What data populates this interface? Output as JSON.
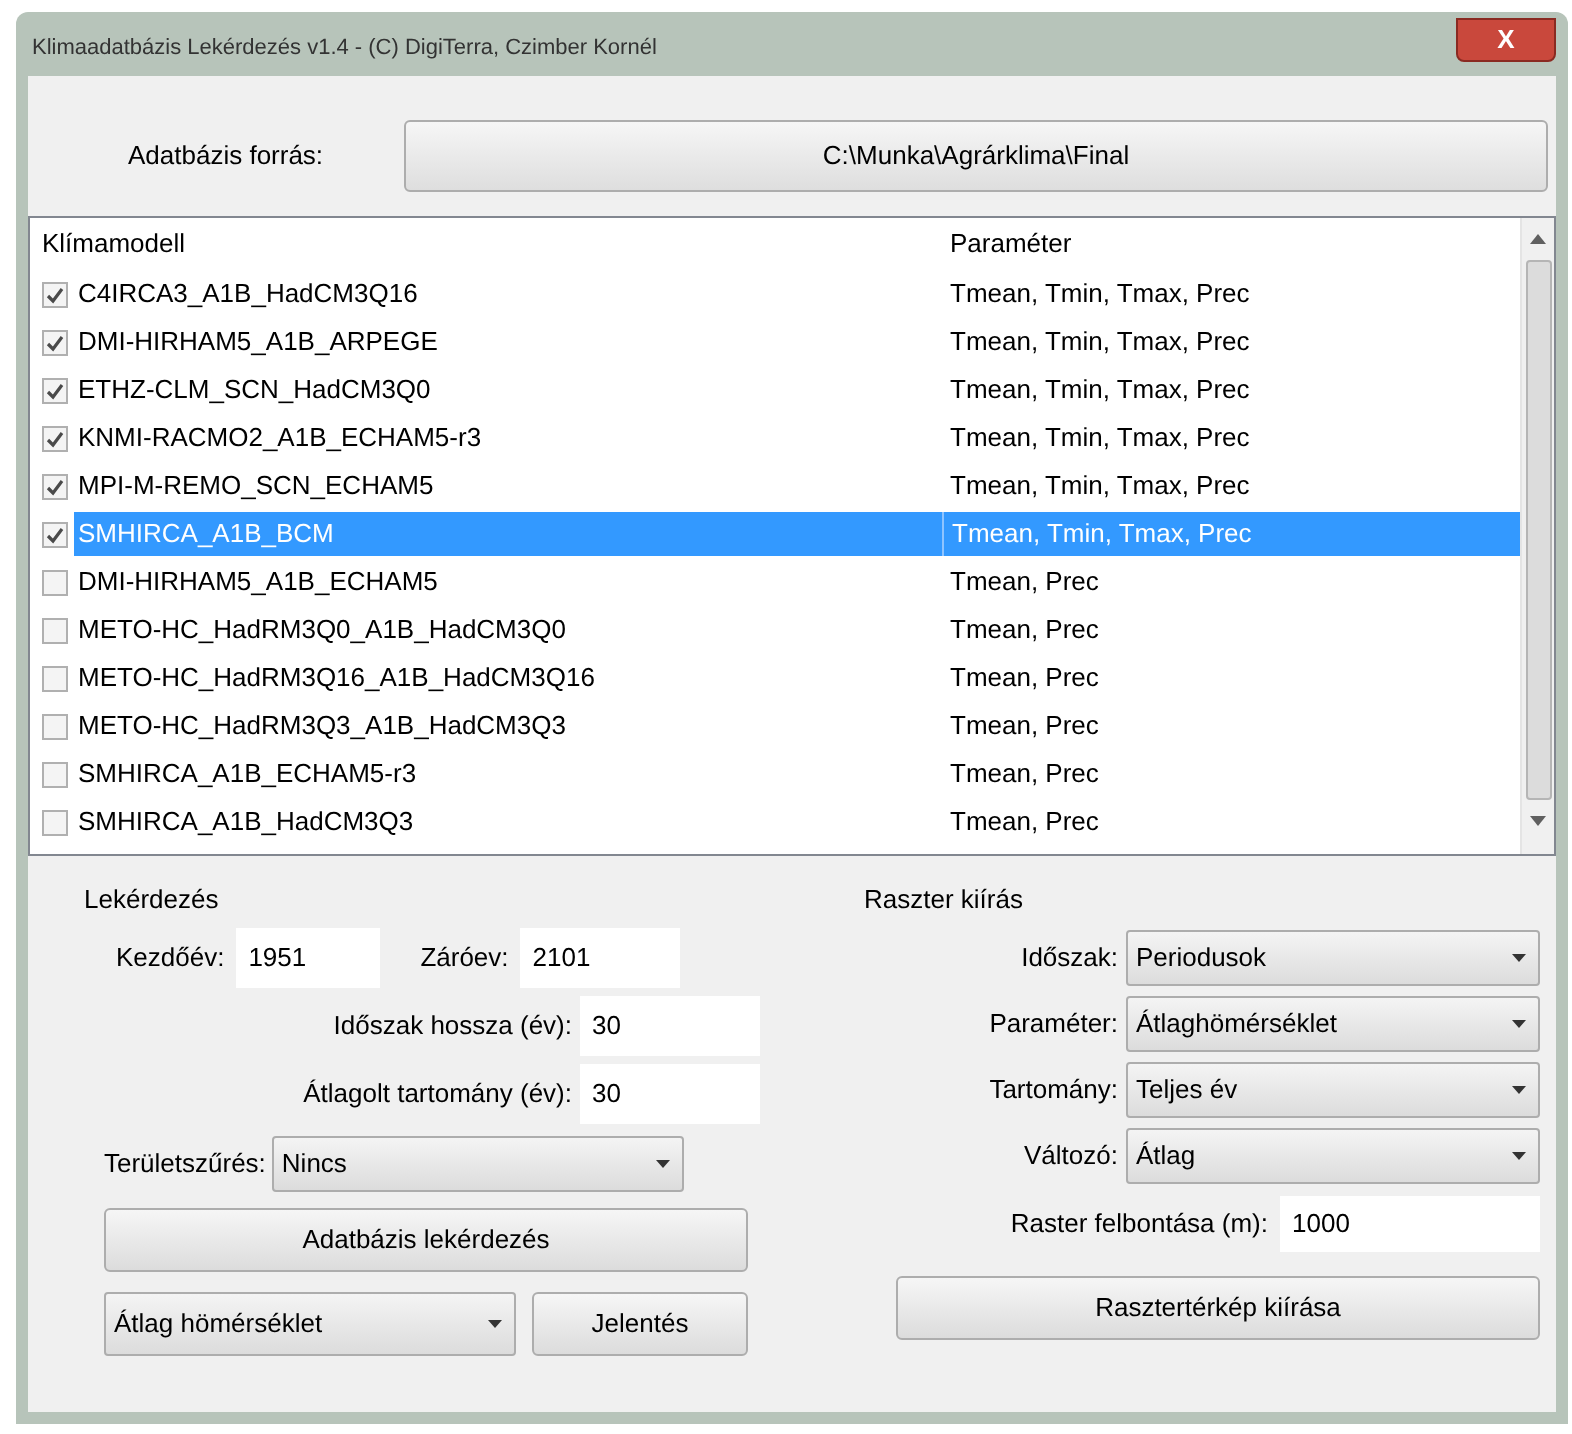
{
  "window": {
    "title": "Klimaadatbázis Lekérdezés v1.4 - (C) DigiTerra, Czimber Kornél",
    "close": "X"
  },
  "source": {
    "label": "Adatbázis forrás:",
    "button": "C:\\Munka\\Agrárklima\\Final"
  },
  "list": {
    "columns": [
      "Klímamodell",
      "Paraméter"
    ],
    "rows": [
      {
        "model": "C4IRCA3_A1B_HadCM3Q16",
        "parameter": "Tmean, Tmin, Tmax, Prec",
        "checked": true,
        "selected": false
      },
      {
        "model": "DMI-HIRHAM5_A1B_ARPEGE",
        "parameter": "Tmean, Tmin, Tmax, Prec",
        "checked": true,
        "selected": false
      },
      {
        "model": "ETHZ-CLM_SCN_HadCM3Q0",
        "parameter": "Tmean, Tmin, Tmax, Prec",
        "checked": true,
        "selected": false
      },
      {
        "model": "KNMI-RACMO2_A1B_ECHAM5-r3",
        "parameter": "Tmean, Tmin, Tmax, Prec",
        "checked": true,
        "selected": false
      },
      {
        "model": "MPI-M-REMO_SCN_ECHAM5",
        "parameter": "Tmean, Tmin, Tmax, Prec",
        "checked": true,
        "selected": false
      },
      {
        "model": "SMHIRCA_A1B_BCM",
        "parameter": "Tmean, Tmin, Tmax, Prec",
        "checked": true,
        "selected": true
      },
      {
        "model": "DMI-HIRHAM5_A1B_ECHAM5",
        "parameter": "Tmean, Prec",
        "checked": false,
        "selected": false
      },
      {
        "model": "METO-HC_HadRM3Q0_A1B_HadCM3Q0",
        "parameter": "Tmean, Prec",
        "checked": false,
        "selected": false
      },
      {
        "model": "METO-HC_HadRM3Q16_A1B_HadCM3Q16",
        "parameter": "Tmean, Prec",
        "checked": false,
        "selected": false
      },
      {
        "model": "METO-HC_HadRM3Q3_A1B_HadCM3Q3",
        "parameter": "Tmean, Prec",
        "checked": false,
        "selected": false
      },
      {
        "model": "SMHIRCA_A1B_ECHAM5-r3",
        "parameter": "Tmean, Prec",
        "checked": false,
        "selected": false
      },
      {
        "model": "SMHIRCA_A1B_HadCM3Q3",
        "parameter": "Tmean, Prec",
        "checked": false,
        "selected": false
      }
    ]
  },
  "query": {
    "title": "Lekérdezés",
    "start_label": "Kezdőév:",
    "start_value": "1951",
    "end_label": "Záróev:",
    "end_value": "2101",
    "period_label": "Időszak hossza (év):",
    "period_value": "30",
    "avg_label": "Átlagolt tartomány (év):",
    "avg_value": "30",
    "filter_label": "Területszűrés:",
    "filter_value": "Nincs",
    "query_button": "Adatbázis lekérdezés",
    "report_select": "Átlag hömérséklet",
    "report_button": "Jelentés"
  },
  "raster": {
    "title": "Raszter kiírás",
    "selects": [
      {
        "label": "Időszak:",
        "value": "Periodusok"
      },
      {
        "label": "Paraméter:",
        "value": "Átlaghömérséklet"
      },
      {
        "label": "Tartomány:",
        "value": "Teljes év"
      },
      {
        "label": "Változó:",
        "value": "Átlag"
      }
    ],
    "resolution_label": "Raster felbontása (m):",
    "resolution_value": "1000",
    "button": "Rasztertérkép kiírása"
  }
}
